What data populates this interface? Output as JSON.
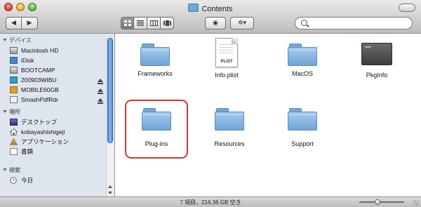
{
  "window": {
    "title": "Contents"
  },
  "toolbar": {
    "back_glyph": "◀",
    "forward_glyph": "▶",
    "view_icons": [
      "icon-view-icon",
      "list-view-icon",
      "column-view-icon",
      "coverflow-view-icon"
    ],
    "quicklook_glyph": "◉",
    "action_glyph": "✲▾",
    "search_placeholder": ""
  },
  "sidebar": {
    "devices_header": "デバイス",
    "devices": [
      {
        "label": "Macintosh HD",
        "icon": "hard-disk-icon",
        "eject": false
      },
      {
        "label": "iDisk",
        "icon": "idisk-icon",
        "eject": false
      },
      {
        "label": "BOOTCAMP",
        "icon": "hard-disk-icon",
        "eject": false
      },
      {
        "label": "200903WIBU",
        "icon": "network-volume-icon",
        "eject": true
      },
      {
        "label": "MOBILE60GB",
        "icon": "external-drive-icon",
        "eject": true
      },
      {
        "label": "SmashPdfRdr",
        "icon": "disk-image-icon",
        "eject": true
      }
    ],
    "places_header": "場所",
    "places": [
      {
        "label": "デスクトップ",
        "icon": "desktop-icon"
      },
      {
        "label": "kobayashishigeji",
        "icon": "home-icon"
      },
      {
        "label": "アプリケーション",
        "icon": "applications-icon"
      },
      {
        "label": "書類",
        "icon": "documents-icon"
      }
    ],
    "search_header": "検索",
    "search_items": [
      {
        "label": "今日",
        "icon": "clock-icon"
      }
    ]
  },
  "content": {
    "items": [
      {
        "label": "Frameworks",
        "kind": "folder"
      },
      {
        "label": "Info.plist",
        "kind": "plist",
        "badge": "PLIST"
      },
      {
        "label": "MacOS",
        "kind": "folder"
      },
      {
        "label": "PkgInfo",
        "kind": "exec"
      },
      {
        "label": "Plug-ins",
        "kind": "folder"
      },
      {
        "label": "Resources",
        "kind": "folder"
      },
      {
        "label": "Support",
        "kind": "folder"
      }
    ],
    "highlight_color": "#d0372f"
  },
  "status": {
    "text": "7 項目、216.36 GB 空き"
  }
}
